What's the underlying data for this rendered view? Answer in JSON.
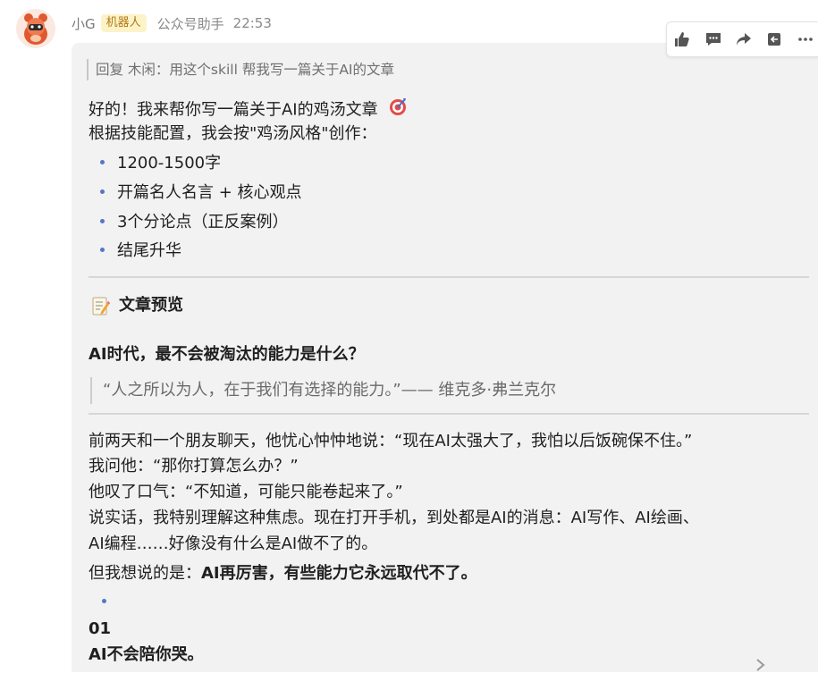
{
  "header": {
    "sender_name": "小G",
    "bot_badge": "机器人",
    "source": "公众号助手",
    "time": "22:53"
  },
  "reply": {
    "text": "回复 木闲：用这个skill 帮我写一篇关于AI的文章"
  },
  "toolbar": {
    "icons": [
      "thumbs-up-icon",
      "comment-icon",
      "forward-icon",
      "collapse-icon",
      "more-icon"
    ]
  },
  "message": {
    "intro_line": "好的！我来帮你写一篇关于AI的鸡汤文章",
    "intro_emoji_icon": "target-icon",
    "config_line": "根据技能配置，我会按\"鸡汤风格\"创作：",
    "bullets": [
      "1200-1500字",
      "开篇名人名言 + 核心观点",
      "3个分论点（正反案例）",
      "结尾升华"
    ],
    "section_title": "文章预览",
    "section_icon": "memo-icon",
    "article_title": "AI时代，最不会被淘汰的能力是什么？",
    "quote": "“人之所以为人，在于我们有选择的能力。”—— 维克多·弗兰克尔",
    "paragraphs": [
      "前两天和一个朋友聊天，他忧心忡忡地说：“现在AI太强大了，我怕以后饭碗保不住。”",
      "我问他：“那你打算怎么办？”",
      "他叹了口气：“不知道，可能只能卷起来了。”",
      "说实话，我特别理解这种焦虑。现在打开手机，到处都是AI的消息：AI写作、AI绘画、",
      "AI编程……好像没有什么是AI做不了的。"
    ],
    "last_line_prefix": "但我想说的是：",
    "last_line_bold": "AI再厉害，有些能力它永远取代不了。",
    "point_number": "01",
    "point_title": "AI不会陪你哭。"
  },
  "colors": {
    "bubble_bg": "#f2f2f2",
    "bullet_dot": "#5576c4",
    "badge_bg": "#fdf3c8",
    "badge_text": "#b07a14"
  }
}
